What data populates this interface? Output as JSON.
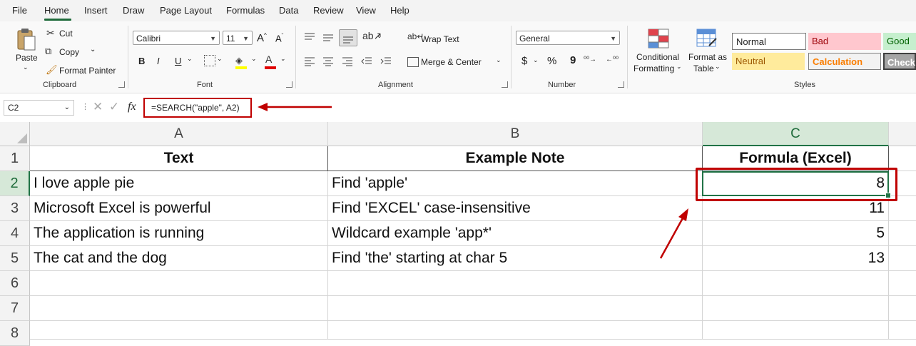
{
  "menu": {
    "items": [
      "File",
      "Home",
      "Insert",
      "Draw",
      "Page Layout",
      "Formulas",
      "Data",
      "Review",
      "View",
      "Help"
    ],
    "active": "Home"
  },
  "clipboard": {
    "paste": "Paste",
    "cut": "Cut",
    "copy": "Copy",
    "format_painter": "Format Painter",
    "label": "Clipboard"
  },
  "font": {
    "name": "Calibri",
    "size": "11",
    "bold": "B",
    "italic": "I",
    "underline": "U",
    "label": "Font"
  },
  "alignment": {
    "wrap_text": "Wrap Text",
    "merge_center": "Merge & Center",
    "label": "Alignment"
  },
  "number": {
    "format": "General",
    "currency": "$",
    "percent": "%",
    "comma": "9",
    "label": "Number"
  },
  "styles": {
    "conditional_formatting": [
      "Conditional",
      "Formatting"
    ],
    "format_as_table": [
      "Format as",
      "Table"
    ],
    "cells": [
      {
        "name": "Normal",
        "bg": "#ffffff",
        "color": "#000000"
      },
      {
        "name": "Bad",
        "bg": "#ffc7ce",
        "color": "#9c0006"
      },
      {
        "name": "Good",
        "bg": "#c6efce",
        "color": "#006100"
      },
      {
        "name": "Neutral",
        "bg": "#ffeb9c",
        "color": "#9c5700"
      },
      {
        "name": "Calculation",
        "bg": "#f2f2f2",
        "color": "#fa7d00"
      },
      {
        "name": "Check",
        "bg": "#a5a5a5",
        "color": "#ffffff"
      }
    ],
    "label": "Styles"
  },
  "formula_bar": {
    "name_box": "C2",
    "fx": "fx",
    "formula": "=SEARCH(\"apple\", A2)"
  },
  "sheet": {
    "columns": [
      "A",
      "B",
      "C"
    ],
    "rows": [
      "1",
      "2",
      "3",
      "4",
      "5",
      "6",
      "7",
      "8"
    ],
    "header": [
      "Text",
      "Example Note",
      "Formula (Excel)"
    ],
    "data": [
      [
        "I love apple pie",
        "Find 'apple'",
        "8"
      ],
      [
        "Microsoft Excel is powerful",
        "Find 'EXCEL' case-insensitive",
        "11"
      ],
      [
        "The application is running",
        "Wildcard example 'app*'",
        "5"
      ],
      [
        "The cat and the dog",
        "Find 'the' starting at char 5",
        "13"
      ]
    ],
    "selected_cell": "C2"
  },
  "colors": {
    "accent_green": "#217346",
    "annotation_red": "#c00000"
  }
}
